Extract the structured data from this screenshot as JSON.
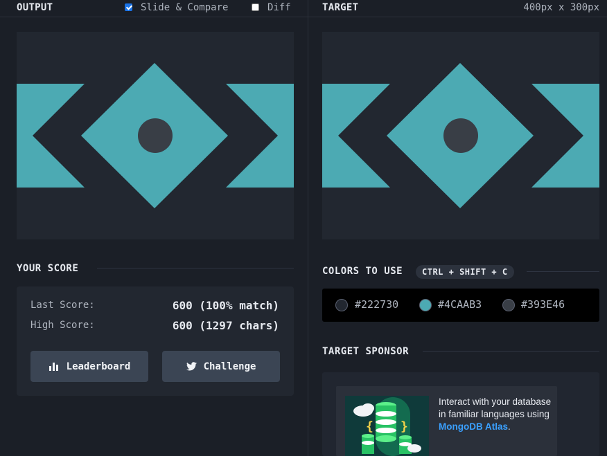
{
  "output_panel": {
    "title": "OUTPUT",
    "slide_compare_label": "Slide & Compare",
    "slide_compare_checked": true,
    "diff_label": "Diff",
    "diff_checked": false
  },
  "target_panel": {
    "title": "TARGET",
    "dimensions": "400px x 300px"
  },
  "score": {
    "section_title": "YOUR SCORE",
    "last_score_label": "Last Score:",
    "last_score_value": "600 (100% match)",
    "high_score_label": "High Score:",
    "high_score_value": "600 (1297 chars)",
    "leaderboard_button": "Leaderboard",
    "challenge_button": "Challenge"
  },
  "colors": {
    "section_title": "COLORS TO USE",
    "shortcut": "CTRL + SHIFT + C",
    "swatches": [
      {
        "hex": "#222730",
        "label": "#222730"
      },
      {
        "hex": "#4CAAB3",
        "label": "#4CAAB3"
      },
      {
        "hex": "#393E46",
        "label": "#393E46"
      }
    ]
  },
  "sponsor": {
    "section_title": "TARGET SPONSOR",
    "text": "Interact with your database in familiar languages using",
    "link_text": "MongoDB Atlas",
    "suffix": "."
  },
  "theme": {
    "accent": "#4CAAB3",
    "background": "#222730",
    "dot": "#393E46"
  }
}
